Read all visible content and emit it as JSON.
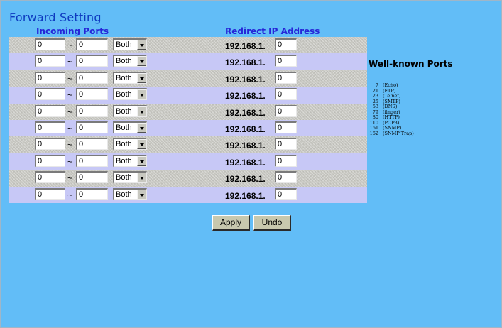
{
  "page": {
    "title": "Forward Setting"
  },
  "headers": {
    "incoming_ports": "Incoming Ports",
    "redirect_ip": "Redirect IP Address"
  },
  "rows": [
    {
      "port_start": "0",
      "separator": "~",
      "port_end": "0",
      "protocol": "Both",
      "ip_prefix": "192.168.1.",
      "ip_last": "0"
    },
    {
      "port_start": "0",
      "separator": "~",
      "port_end": "0",
      "protocol": "Both",
      "ip_prefix": "192.168.1.",
      "ip_last": "0"
    },
    {
      "port_start": "0",
      "separator": "~",
      "port_end": "0",
      "protocol": "Both",
      "ip_prefix": "192.168.1.",
      "ip_last": "0"
    },
    {
      "port_start": "0",
      "separator": "~",
      "port_end": "0",
      "protocol": "Both",
      "ip_prefix": "192.168.1.",
      "ip_last": "0"
    },
    {
      "port_start": "0",
      "separator": "~",
      "port_end": "0",
      "protocol": "Both",
      "ip_prefix": "192.168.1.",
      "ip_last": "0"
    },
    {
      "port_start": "0",
      "separator": "~",
      "port_end": "0",
      "protocol": "Both",
      "ip_prefix": "192.168.1.",
      "ip_last": "0"
    },
    {
      "port_start": "0",
      "separator": "~",
      "port_end": "0",
      "protocol": "Both",
      "ip_prefix": "192.168.1.",
      "ip_last": "0"
    },
    {
      "port_start": "0",
      "separator": "~",
      "port_end": "0",
      "protocol": "Both",
      "ip_prefix": "192.168.1.",
      "ip_last": "0"
    },
    {
      "port_start": "0",
      "separator": "~",
      "port_end": "0",
      "protocol": "Both",
      "ip_prefix": "192.168.1.",
      "ip_last": "0"
    },
    {
      "port_start": "0",
      "separator": "~",
      "port_end": "0",
      "protocol": "Both",
      "ip_prefix": "192.168.1.",
      "ip_last": "0"
    }
  ],
  "well_known": {
    "title": "Well-known Ports",
    "items": [
      {
        "port": "7",
        "name": "(Echo)"
      },
      {
        "port": "21",
        "name": "(FTP)"
      },
      {
        "port": "23",
        "name": "(Telnet)"
      },
      {
        "port": "25",
        "name": "(SMTP)"
      },
      {
        "port": "53",
        "name": "(DNS)"
      },
      {
        "port": "79",
        "name": "(finger)"
      },
      {
        "port": "80",
        "name": "(HTTP)"
      },
      {
        "port": "110",
        "name": "(POP3)"
      },
      {
        "port": "161",
        "name": "(SNMP)"
      },
      {
        "port": "162",
        "name": "(SNMP Trap)"
      }
    ]
  },
  "buttons": {
    "apply": "Apply",
    "undo": "Undo"
  },
  "colors": {
    "background": "#62bdf7",
    "row_odd": "#c8c8c2",
    "row_even": "#c7c8f6",
    "title": "#0d3ac0",
    "header": "#2626d8"
  }
}
